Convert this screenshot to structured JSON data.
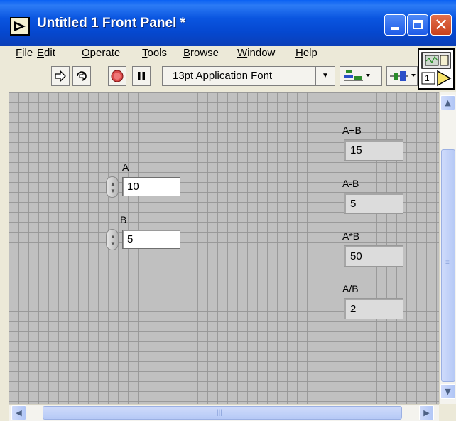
{
  "window": {
    "title": "Untitled 1 Front Panel *",
    "titlebar_color": "#0a55e0",
    "close_color": "#d4492a"
  },
  "menu": {
    "items": [
      {
        "label_u": "F",
        "label_rest": "ile"
      },
      {
        "label_u": "E",
        "label_rest": "dit"
      },
      {
        "label_u": "O",
        "label_rest": "perate"
      },
      {
        "label_u": "T",
        "label_rest": "ools"
      },
      {
        "label_u": "B",
        "label_rest": "rowse"
      },
      {
        "label_u": "W",
        "label_rest": "indow"
      },
      {
        "label_u": "H",
        "label_rest": "elp"
      }
    ]
  },
  "toolbar": {
    "run_icon": "run-arrow-icon",
    "run_continuous_icon": "run-continuously-icon",
    "abort_icon": "abort-icon",
    "pause_icon": "pause-icon",
    "font": "13pt Application Font",
    "vi_icon_number": "1"
  },
  "panel": {
    "grid_color": "#c0c0c0",
    "controls": [
      {
        "label": "A",
        "value": "10"
      },
      {
        "label": "B",
        "value": "5"
      }
    ],
    "indicators": [
      {
        "label": "A+B",
        "value": "15"
      },
      {
        "label": "A-B",
        "value": "5"
      },
      {
        "label": "A*B",
        "value": "50"
      },
      {
        "label": "A/B",
        "value": "2"
      }
    ]
  }
}
